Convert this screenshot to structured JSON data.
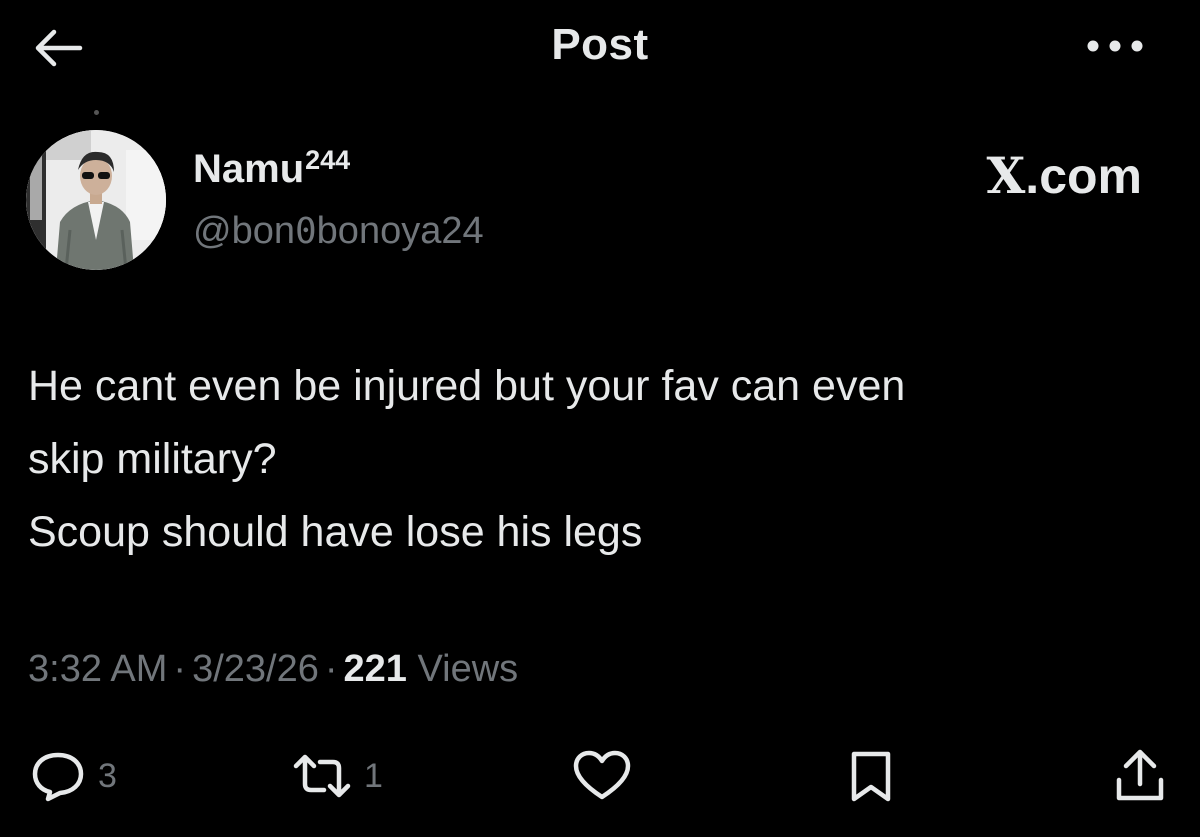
{
  "header": {
    "title": "Post",
    "back_icon": "arrow-left-icon",
    "more_icon": "more-horizontal-icon"
  },
  "author": {
    "display_name": "Namu",
    "display_name_superscript": "244",
    "handle_prefix": "@bon",
    "handle_zero": "0",
    "handle_suffix": "bonoya24"
  },
  "watermark": {
    "x_letter": "X",
    "domain": ".com"
  },
  "post": {
    "lines": [
      "He cant even be injured but your fav can even",
      "skip military?",
      "Scoup should have lose his legs"
    ]
  },
  "meta": {
    "time": "3:32 AM",
    "separator": "·",
    "date": "3/23/26",
    "views_count": "221",
    "views_label": "Views"
  },
  "actions": {
    "replies": "3",
    "reposts": "1",
    "icons": [
      "reply-icon",
      "repost-icon",
      "like-icon",
      "bookmark-icon",
      "share-icon"
    ]
  },
  "colors": {
    "background": "#000000",
    "primary_text": "#e7e9ea",
    "secondary_text": "#71767b"
  }
}
